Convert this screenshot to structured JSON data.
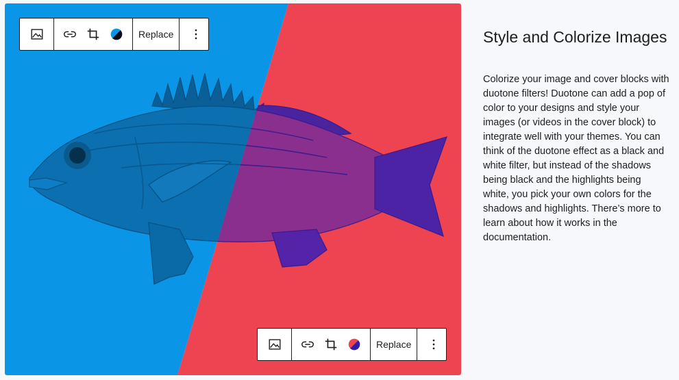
{
  "toolbar": {
    "replace_label": "Replace"
  },
  "icons": {
    "image": "image-icon",
    "link": "link-icon",
    "crop": "crop-icon",
    "duotone": "duotone-icon",
    "more": "more-vertical-icon"
  },
  "colors": {
    "duotone_blue": "#0a95e6",
    "duotone_red": "#ee4350",
    "duotone_shadow": "#2f1fa8"
  },
  "text_panel": {
    "title": "Style and Colorize Images",
    "body": "Colorize your image and cover blocks with duotone filters! Duotone can add a pop of color to your designs and style your images (or videos in the cover block) to integrate well with your themes. You can think of the duotone effect as a black and white filter, but instead of the shadows being black and the highlights being white, you pick your own colors for the shadows and highlights. There’s more to learn about how it works in the documentation."
  }
}
